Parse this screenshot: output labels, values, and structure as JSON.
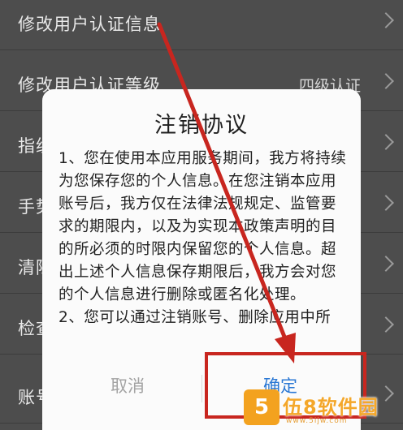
{
  "settings": {
    "rows": [
      {
        "label": "修改用户认证信息",
        "value": ""
      },
      {
        "label": "修改用户认证等级",
        "value": "四级认证"
      },
      {
        "label": "指纹",
        "value": ""
      },
      {
        "label": "手势",
        "value": ""
      },
      {
        "label": "清除",
        "value": ""
      },
      {
        "label": "检查",
        "value": ""
      },
      {
        "label": "账号",
        "value": ""
      }
    ]
  },
  "dialog": {
    "title": "注销协议",
    "paragraphs": [
      "1、您在使用本应用服务期间，我方将持续为您保存您的个人信息。在您注销本应用账号后，我方仅在法律法规规定、监管要求的期限内，以及为实现本政策声明的目的所必须的时限内保留您的个人信息。超出上述个人信息保存期限后，我方会对您的个人信息进行删除或匿名化处理。",
      "2、您可以通过注销账号、删除应用中所"
    ],
    "cancel_label": "取消",
    "confirm_label": "确定"
  },
  "annotation": {
    "arrow_color": "#c8261f",
    "box_color": "#c8261f"
  },
  "watermark": {
    "logo_char": "5",
    "text": "伍8软件园",
    "sub": "www.5ijw.com"
  }
}
